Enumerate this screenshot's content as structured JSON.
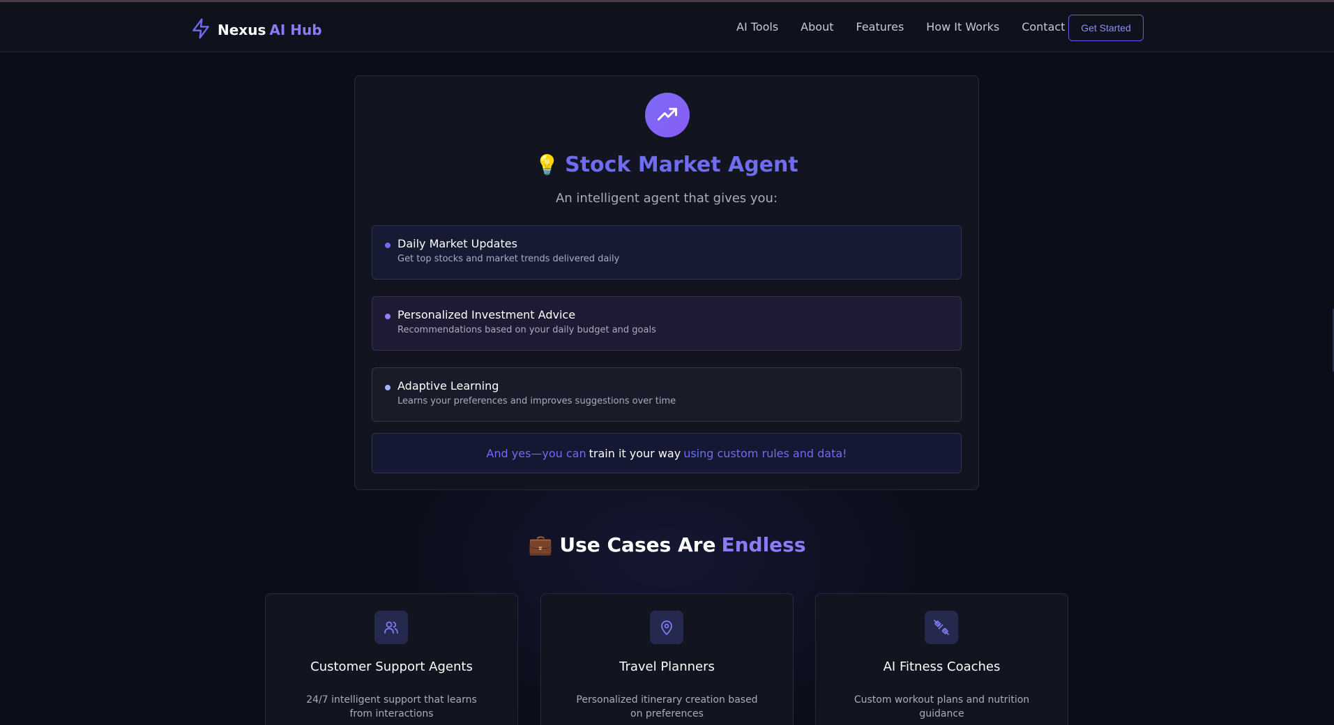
{
  "navbar": {
    "brand": "Nexus",
    "brand_accent": "AI Hub",
    "links": [
      "AI Tools",
      "About",
      "Features",
      "How It Works",
      "Contact"
    ],
    "cta": "Get Started"
  },
  "agent": {
    "icon": "trending-up-icon",
    "emoji": "💡",
    "title": "Stock Market Agent",
    "subtitle": "An intelligent agent that gives you:",
    "features": [
      {
        "title": "Daily Market Updates",
        "desc": "Get top stocks and market trends delivered daily"
      },
      {
        "title": "Personalized Investment Advice",
        "desc": "Recommendations based on your daily budget and goals"
      },
      {
        "title": "Adaptive Learning",
        "desc": "Learns your preferences and improves suggestions over time"
      }
    ],
    "train": {
      "part1": "And yes—you can",
      "part2": "train it your way",
      "part3": "using custom rules and data!"
    }
  },
  "use_cases": {
    "emoji": "💼",
    "title": "Use Cases Are",
    "title_accent": "Endless",
    "cards": [
      {
        "icon": "users-icon",
        "name": "Customer Support Agents",
        "desc": "24/7 intelligent support that learns from interactions"
      },
      {
        "icon": "map-pin-icon",
        "name": "Travel Planners",
        "desc": "Personalized itinerary creation based on preferences"
      },
      {
        "icon": "dumbbell-icon",
        "name": "AI Fitness Coaches",
        "desc": "Custom workout plans and nutrition guidance"
      }
    ]
  },
  "colors": {
    "background": "#0b0d18",
    "accent": "#6f6cf0",
    "accent_purple": "#8b7cf6",
    "text_muted": "#a9adbf"
  }
}
